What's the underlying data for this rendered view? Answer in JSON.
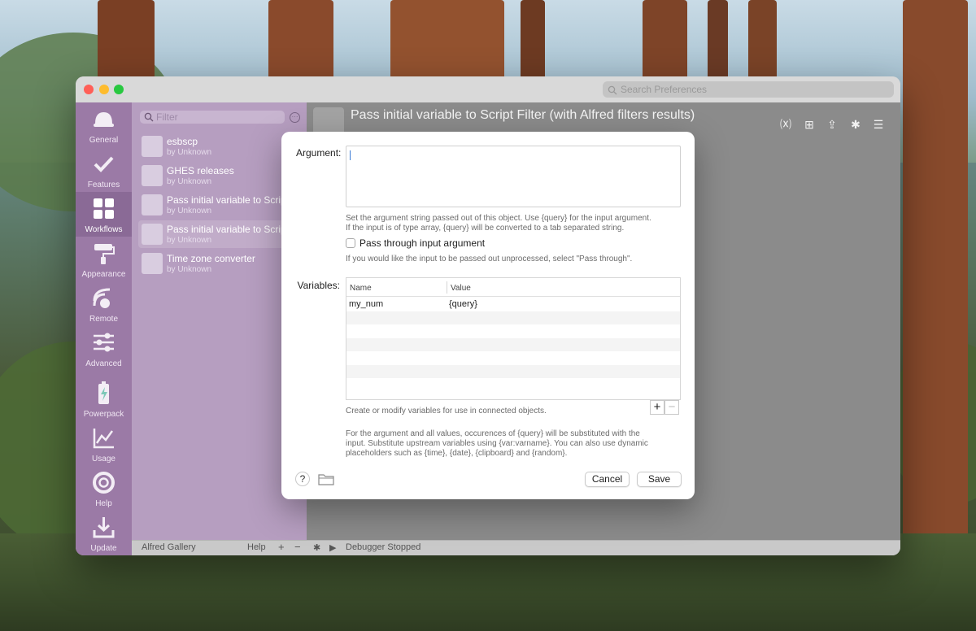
{
  "window": {
    "search_placeholder": "Search Preferences"
  },
  "sidebar": {
    "items": [
      {
        "label": "General",
        "icon": "hat-icon"
      },
      {
        "label": "Features",
        "icon": "checkmark-icon"
      },
      {
        "label": "Workflows",
        "icon": "workflows-grid-icon"
      },
      {
        "label": "Appearance",
        "icon": "paint-roller-icon"
      },
      {
        "label": "Remote",
        "icon": "remote-icon"
      },
      {
        "label": "Advanced",
        "icon": "sliders-icon"
      },
      {
        "label": "Powerpack",
        "icon": "battery-bolt-icon"
      },
      {
        "label": "Usage",
        "icon": "chart-icon"
      },
      {
        "label": "Help",
        "icon": "lifebuoy-icon"
      },
      {
        "label": "Update",
        "icon": "download-icon"
      }
    ],
    "active": "Workflows"
  },
  "workflow_list": {
    "filter_placeholder": "Filter",
    "items": [
      {
        "name": "esbscp",
        "author": "by Unknown"
      },
      {
        "name": "GHES releases",
        "author": "by Unknown"
      },
      {
        "name": "Pass initial variable to Script Filter",
        "author": "by Unknown"
      },
      {
        "name": "Pass initial variable to Script Filter (with Alfred filters results)",
        "author": "by Unknown",
        "selected": true
      },
      {
        "name": "Time zone converter",
        "author": "by Unknown"
      }
    ]
  },
  "header": {
    "title": "Pass initial variable to Script Filter (with Alfred filters results)",
    "tool_icons": [
      "variables-icon",
      "add-object-icon",
      "share-icon",
      "debug-bug-icon",
      "list-menu-icon"
    ]
  },
  "bottom_bar": {
    "gallery": "Alfred Gallery",
    "help": "Help",
    "add": "+",
    "remove": "−",
    "debugger_status": "Debugger Stopped"
  },
  "modal": {
    "argument_label": "Argument:",
    "argument_value": "",
    "argument_help_1": "Set the argument string passed out of this object. Use {query} for the input argument.",
    "argument_help_2": "If the input is of type array, {query} will be converted to a tab separated string.",
    "passthrough_label": "Pass through input argument",
    "passthrough_checked": false,
    "passthrough_help": "If you would like the input to be passed out unprocessed, select \"Pass through\".",
    "variables_label": "Variables:",
    "variables_columns": [
      "Name",
      "Value"
    ],
    "variables_rows": [
      {
        "name": "my_num",
        "value": "{query}"
      }
    ],
    "variables_help": "Create or modify variables for use in connected objects.",
    "footer_help_1": "For the argument and all values, occurences of {query} will be substituted with the",
    "footer_help_2": "input. Substitute upstream variables using {var:varname}. You can also use dynamic",
    "footer_help_3": "placeholders such as {time}, {date}, {clipboard} and {random}.",
    "add_button": "+",
    "remove_button": "−",
    "help_button": "?",
    "cancel_button": "Cancel",
    "save_button": "Save"
  },
  "colors": {
    "sidebar_bg": "#9b7aa6",
    "list_bg": "#b69ec0",
    "canvas_bg": "#8b8b8b",
    "traffic_red": "#ff5f57",
    "traffic_yellow": "#febc2e",
    "traffic_green": "#28c840"
  }
}
